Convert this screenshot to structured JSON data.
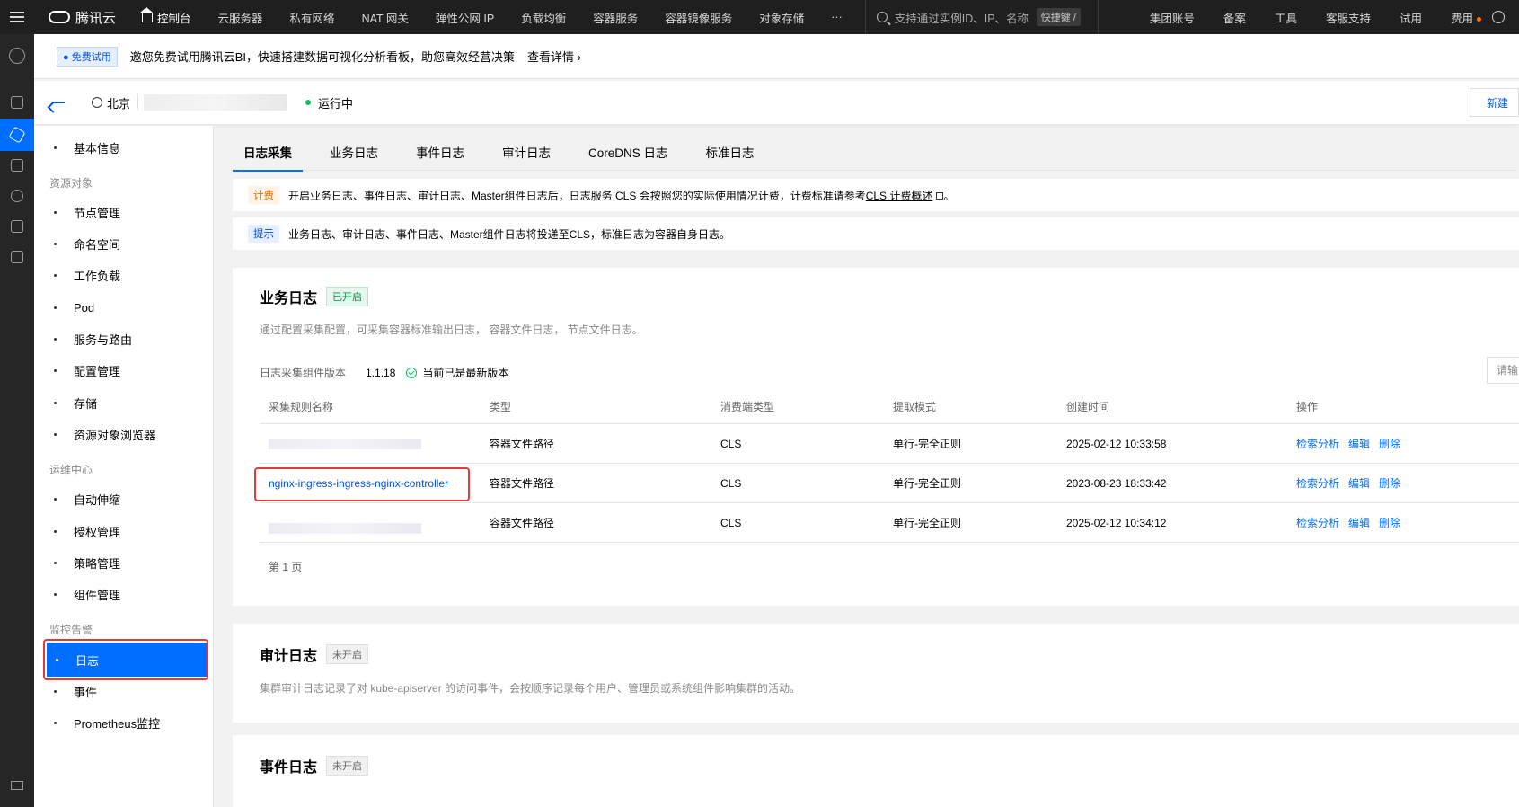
{
  "topnav": {
    "brand": "腾讯云",
    "home": "控制台",
    "items": [
      "云服务器",
      "私有网络",
      "NAT 网关",
      "弹性公网 IP",
      "负载均衡",
      "容器服务",
      "容器镜像服务",
      "对象存储",
      "···"
    ],
    "search_placeholder": "支持通过实例ID、IP、名称",
    "shortcut": "快捷键 /",
    "right_items": [
      "集团账号",
      "备案",
      "工具",
      "客服支持",
      "试用",
      "费用"
    ]
  },
  "banner": {
    "badge": "● 免费试用",
    "text": "邀您免费试用腾讯云BI，快速搭建数据可视化分析看板，助您高效经营决策",
    "link": "查看详情 ›"
  },
  "cluster": {
    "region": "北京",
    "status": "运行中",
    "new_button": "新建"
  },
  "sidebar": {
    "basic": "基本信息",
    "group1": "资源对象",
    "g1_items": [
      "节点管理",
      "命名空间",
      "工作负载",
      "Pod",
      "服务与路由",
      "配置管理",
      "存储",
      "资源对象浏览器"
    ],
    "group2": "运维中心",
    "g2_items": [
      "自动伸缩",
      "授权管理",
      "策略管理",
      "组件管理"
    ],
    "group3": "监控告警",
    "g3_items": [
      "日志",
      "事件",
      "Prometheus监控"
    ]
  },
  "tabs": [
    "日志采集",
    "业务日志",
    "事件日志",
    "审计日志",
    "CoreDNS 日志",
    "标准日志"
  ],
  "notice_fee": {
    "tag": "计费",
    "text": "开启业务日志、事件日志、审计日志、Master组件日志后，日志服务 CLS 会按照您的实际使用情况计费，计费标准请参考",
    "link": "CLS 计费概述",
    "suffix": "。"
  },
  "notice_tip": {
    "tag": "提示",
    "text": "业务日志、审计日志、事件日志、Master组件日志将投递至CLS，标准日志为容器自身日志。"
  },
  "business_log": {
    "title": "业务日志",
    "status": "已开启",
    "desc": "通过配置采集配置，可采集容器标准输出日志， 容器文件日志， 节点文件日志。",
    "version_label": "日志采集组件版本",
    "version": "1.1.18",
    "version_status": "当前已是最新版本",
    "search_placeholder": "请输入",
    "columns": [
      "采集规则名称",
      "类型",
      "消费端类型",
      "提取模式",
      "创建时间",
      "操作"
    ],
    "rows": [
      {
        "name": "",
        "type": "容器文件路径",
        "consumer": "CLS",
        "mode": "单行-完全正则",
        "created": "2025-02-12 10:33:58"
      },
      {
        "name": "nginx-ingress-ingress-nginx-controller",
        "type": "容器文件路径",
        "consumer": "CLS",
        "mode": "单行-完全正则",
        "created": "2023-08-23 18:33:42"
      },
      {
        "name": "",
        "type": "容器文件路径",
        "consumer": "CLS",
        "mode": "单行-完全正则",
        "created": "2025-02-12 10:34:12"
      }
    ],
    "actions": [
      "检索分析",
      "编辑",
      "删除"
    ],
    "pager": "第 1 页"
  },
  "audit_log": {
    "title": "审计日志",
    "status": "未开启",
    "desc": "集群审计日志记录了对 kube-apiserver 的访问事件，会按顺序记录每个用户、管理员或系统组件影响集群的活动。"
  },
  "event_log": {
    "title": "事件日志",
    "status": "未开启"
  }
}
